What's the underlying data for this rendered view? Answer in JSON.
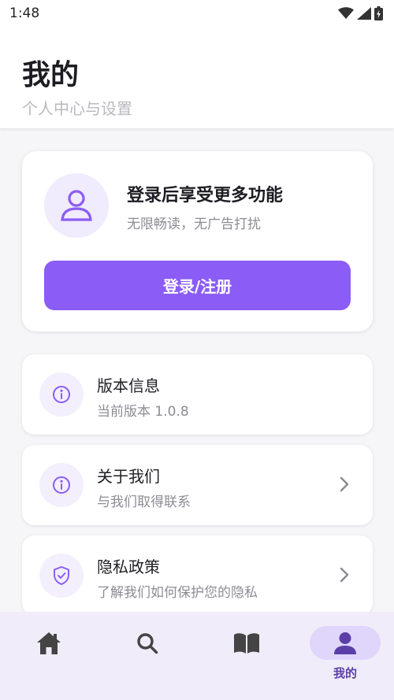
{
  "status_bar": {
    "time": "1:48"
  },
  "header": {
    "title": "我的",
    "subtitle": "个人中心与设置"
  },
  "login_card": {
    "title": "登录后享受更多功能",
    "description": "无限畅读，无广告打扰",
    "button_label": "登录/注册"
  },
  "menu": [
    {
      "title": "版本信息",
      "description": "当前版本 1.0.8",
      "icon": "info-icon",
      "has_chevron": false
    },
    {
      "title": "关于我们",
      "description": "与我们取得联系",
      "icon": "info-icon",
      "has_chevron": true
    },
    {
      "title": "隐私政策",
      "description": "了解我们如何保护您的隐私",
      "icon": "shield-check-icon",
      "has_chevron": true
    }
  ],
  "bottom_nav": {
    "items": [
      {
        "icon": "home-icon",
        "label": ""
      },
      {
        "icon": "search-icon",
        "label": ""
      },
      {
        "icon": "book-icon",
        "label": ""
      },
      {
        "icon": "person-icon",
        "label": "我的",
        "active": true
      }
    ]
  },
  "colors": {
    "accent": "#8b5cf6",
    "accent_light": "#f0ebfd",
    "nav_background": "#f1ecf9",
    "nav_active_pill": "#e0d6fb",
    "nav_active_icon": "#5b3fa8"
  }
}
